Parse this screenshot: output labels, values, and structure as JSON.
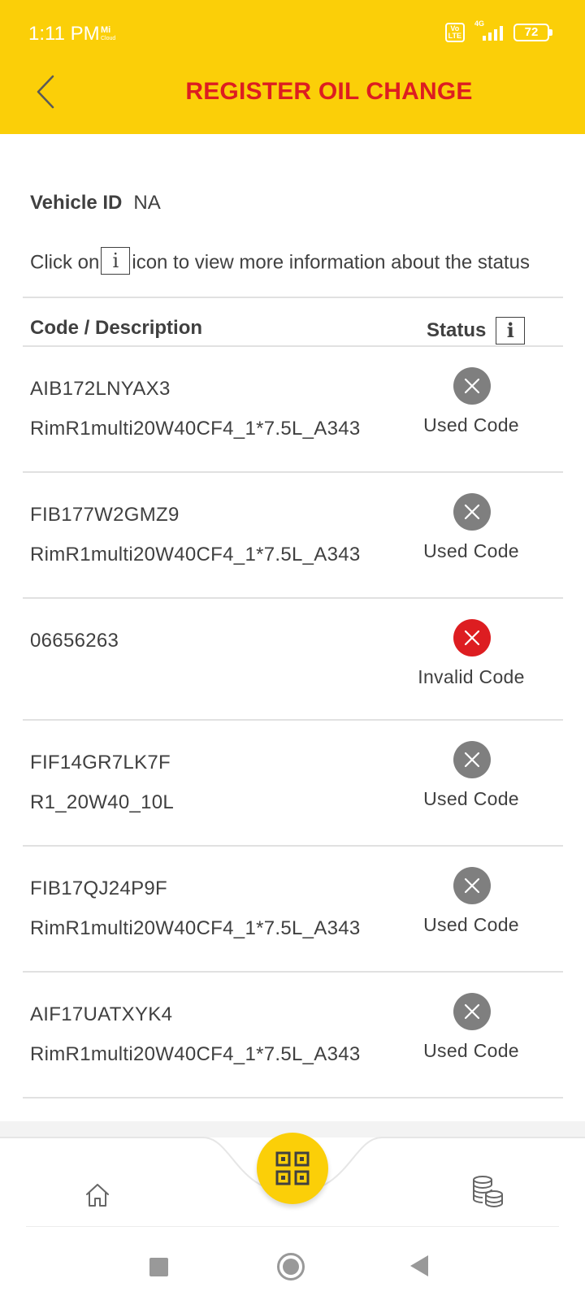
{
  "status_bar": {
    "time": "1:11 PM",
    "mi_text": "Mi\nCloud",
    "network": "4G",
    "volte": "Vo\nLTE",
    "battery": "72"
  },
  "header": {
    "title": "REGISTER OIL CHANGE",
    "back_icon": "chevron-left-icon",
    "background": "#fbcf08",
    "title_color": "#dd1d21"
  },
  "vehicle": {
    "label": "Vehicle ID",
    "value": "NA"
  },
  "info": {
    "prefix": "Click on",
    "icon_glyph": "i",
    "suffix": "icon to view more information about the status"
  },
  "table": {
    "col_code": "Code / Description",
    "col_status": "Status",
    "status_icon_glyph": "i",
    "rows": [
      {
        "code": "AIB172LNYAX3",
        "description": "RimR1multi20W40CF4_1*7.5L_A343",
        "status": "Used Code",
        "status_type": "used"
      },
      {
        "code": "FIB177W2GMZ9",
        "description": "RimR1multi20W40CF4_1*7.5L_A343",
        "status": "Used Code",
        "status_type": "used"
      },
      {
        "code": "06656263",
        "description": "",
        "status": "Invalid Code",
        "status_type": "invalid"
      },
      {
        "code": "FIF14GR7LK7F",
        "description": "R1_20W40_10L",
        "status": "Used Code",
        "status_type": "used"
      },
      {
        "code": "FIB17QJ24P9F",
        "description": "RimR1multi20W40CF4_1*7.5L_A343",
        "status": "Used Code",
        "status_type": "used"
      },
      {
        "code": "AIF17UATXYK4",
        "description": "RimR1multi20W40CF4_1*7.5L_A343",
        "status": "Used Code",
        "status_type": "used"
      }
    ]
  },
  "bottom_nav": {
    "home_icon": "home-icon",
    "scan_icon": "qr-code-icon",
    "coins_icon": "coins-icon"
  },
  "colors": {
    "used": "#7f7f7f",
    "invalid": "#dd1d21",
    "accent": "#fbcf08"
  }
}
